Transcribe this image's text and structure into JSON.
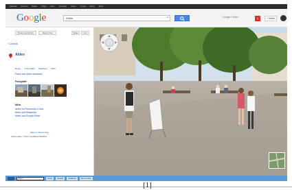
{
  "topnav": {
    "items": [
      "Michael",
      "Suchen",
      "Bilder",
      "Maps",
      "Play",
      "YouTube",
      "News",
      "Gmail",
      "Drive",
      "Mehr"
    ]
  },
  "header": {
    "logo_letters": [
      "G",
      "o",
      "o",
      "g",
      "l",
      "e"
    ],
    "search_value": "Ahlen",
    "right_link": "Google+ teilen",
    "notifications_count": "1",
    "share_label": "+ Teilen"
  },
  "panel": {
    "buttons": [
      "Route berechnen",
      "Meine Orte",
      "Teilen",
      "Link"
    ],
    "back_link": "« Zurück",
    "place_title": "Ahlen",
    "row_links": [
      "Route",
      "In der Nähe",
      "Speichern",
      "Mehr"
    ],
    "photos_link": "Fotos von Ahlen ansehen",
    "photos_label": "Fotografie",
    "more_label": "Mehr",
    "more_links": [
      "Ahlen im Panoramio-Fotos",
      "Ahlen auf Wikipedia",
      "Ahlen auf Google Earth"
    ],
    "footer_note": "Ahlen in Street View",
    "footer_data": "Kartendaten ©2013 GeoBasis-DE/BKG"
  },
  "bottombar": {
    "field_value": "Ahlen",
    "chips": [
      "Karte",
      "Satellit",
      "Gelände",
      "Street View"
    ]
  },
  "caption": "[1]",
  "colors": {
    "google_blue": "#3166d8",
    "bottom_bar": "#5a9bd5",
    "link": "#1a4fb4"
  }
}
